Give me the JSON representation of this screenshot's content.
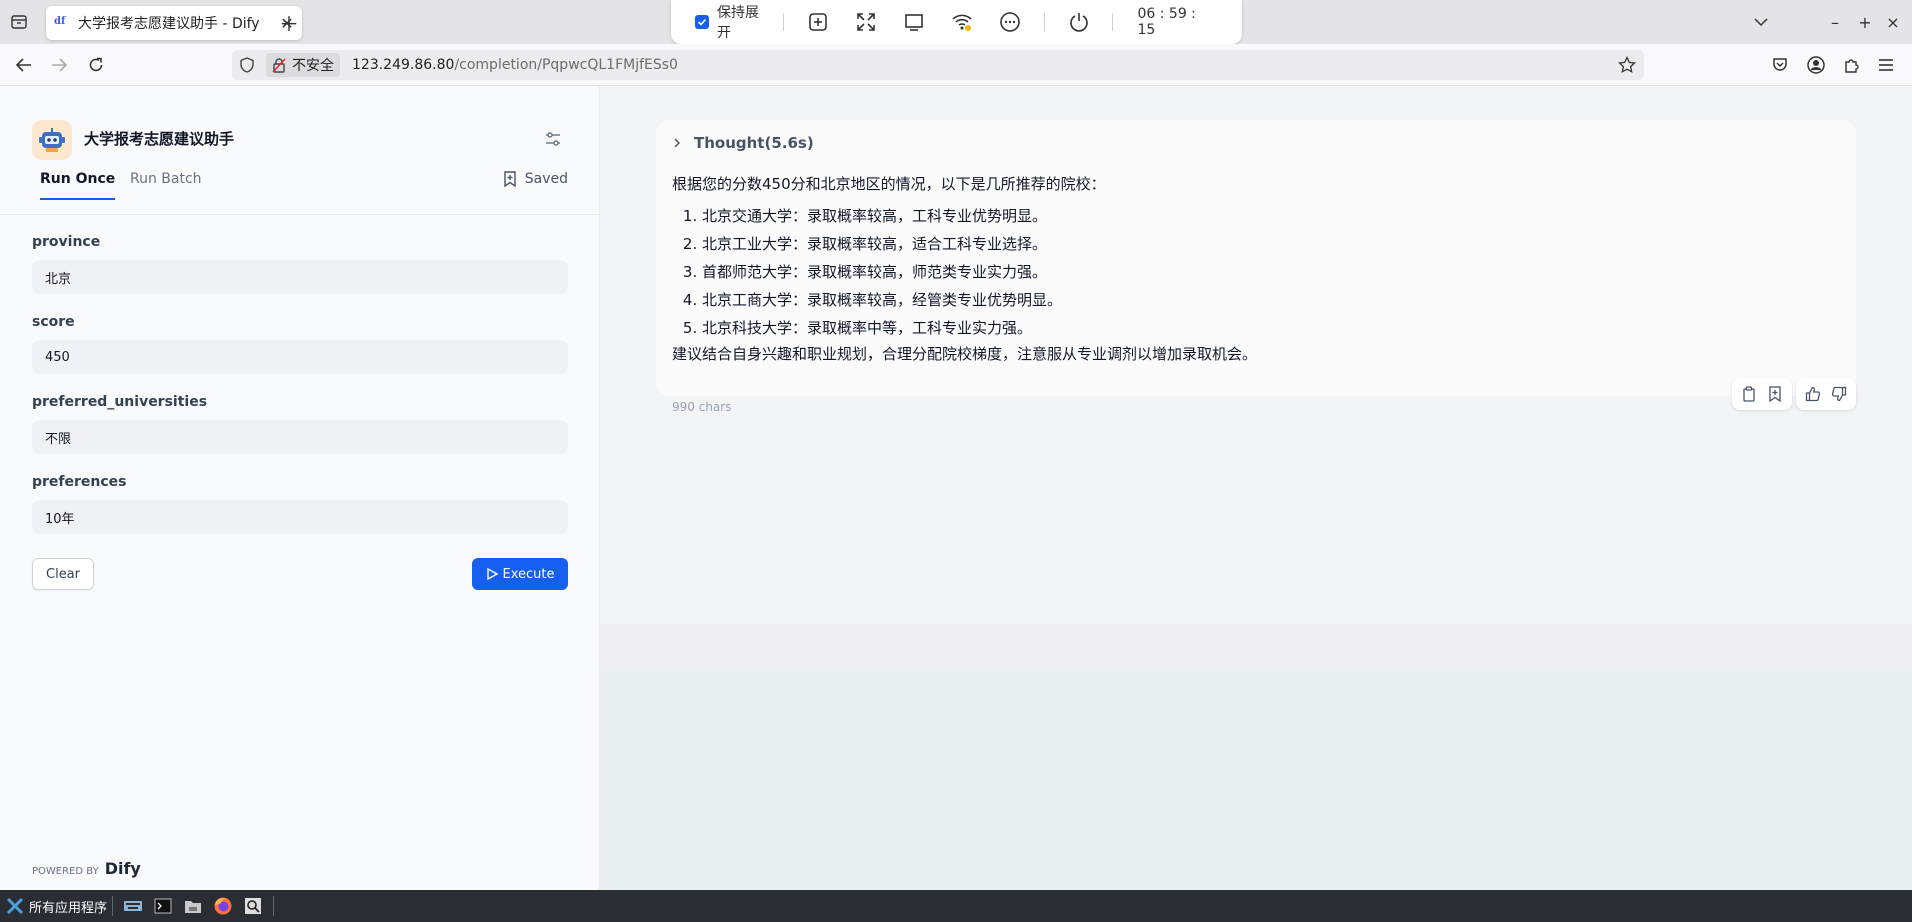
{
  "browser": {
    "tab_title": "大学报考志愿建议助手 - Dify",
    "tab_favicon": "df",
    "insecure_label": "不安全",
    "url_host": "123.249.86.80",
    "url_path": "/completion/PqpwcQL1FMjfESs0"
  },
  "remote_toolbar": {
    "keep_expanded_label": "保持展开",
    "timer": "06 : 59 : 15"
  },
  "app": {
    "name": "大学报考志愿建议助手",
    "tabs": {
      "run_once": "Run Once",
      "run_batch": "Run Batch"
    },
    "saved_label": "Saved",
    "fields": [
      {
        "label": "province",
        "value": "北京"
      },
      {
        "label": "score",
        "value": "450"
      },
      {
        "label": "preferred_universities",
        "value": "不限"
      },
      {
        "label": "preferences",
        "value": "10年"
      }
    ],
    "clear_label": "Clear",
    "execute_label": "Execute",
    "powered_by": "POWERED BY",
    "brand": "Dify"
  },
  "result": {
    "thought_label": "Thought(5.6s)",
    "intro": "根据您的分数450分和北京地区的情况，以下是几所推荐的院校：",
    "items": [
      "北京交通大学：录取概率较高，工科专业优势明显。",
      "北京工业大学：录取概率较高，适合工科专业选择。",
      "首都师范大学：录取概率较高，师范类专业实力强。",
      "北京工商大学：录取概率较高，经管类专业优势明显。",
      "北京科技大学：录取概率中等，工科专业实力强。"
    ],
    "conclusion": "建议结合自身兴趣和职业规划，合理分配院校梯度，注意服从专业调剂以增加录取机会。",
    "char_count": "990 chars"
  },
  "taskbar": {
    "start_label": "所有应用程序"
  },
  "colors": {
    "primary": "#155eef",
    "taskbar": "#2a2d33",
    "tab_strip": "#e3e3e8"
  }
}
